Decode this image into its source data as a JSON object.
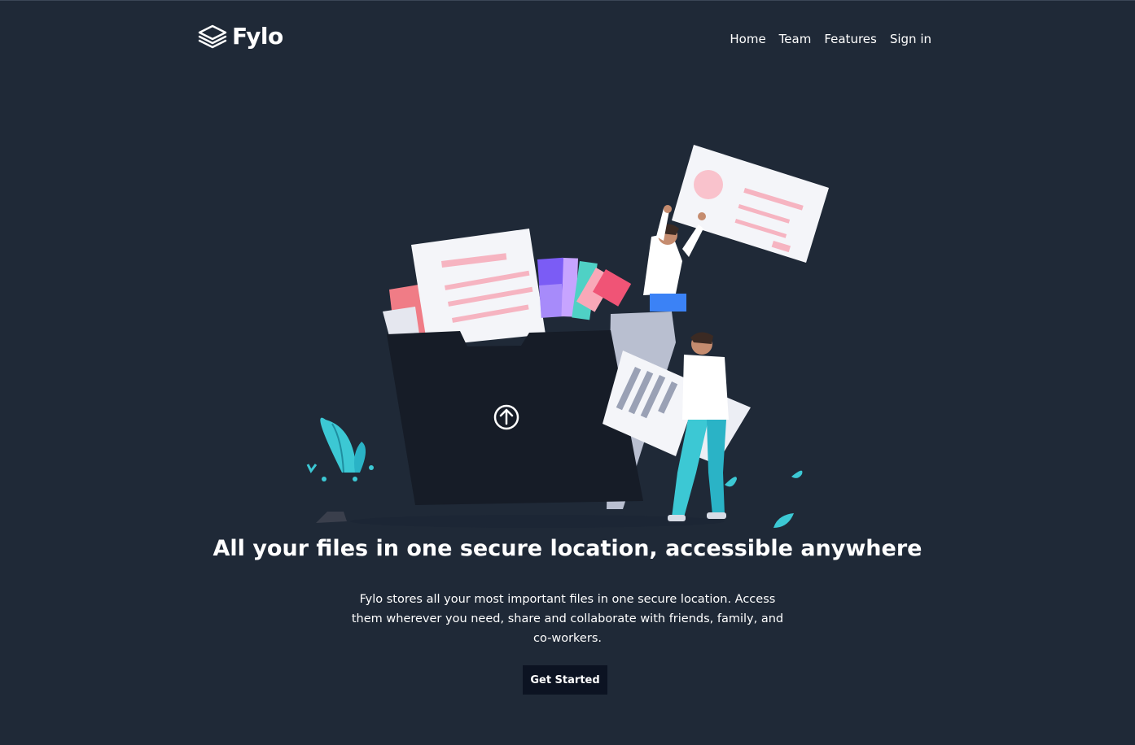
{
  "brand": {
    "name": "Fylo",
    "logo_icon": "stacked-layers-icon"
  },
  "nav": {
    "items": [
      {
        "label": "Home"
      },
      {
        "label": "Team"
      },
      {
        "label": "Features"
      },
      {
        "label": "Sign in"
      }
    ]
  },
  "hero": {
    "illustration": "files-folder-illustration",
    "title": "All your files in one secure location, accessible anywhere",
    "description": "Fylo stores all your most important files in one secure location. Access them wherever you need, share and collaborate with friends, family, and co-workers.",
    "cta_label": "Get Started"
  },
  "colors": {
    "background": "#1f2937",
    "button": "#0c1322",
    "accent_teal": "#3cc8d4",
    "accent_pink": "#f47088"
  }
}
